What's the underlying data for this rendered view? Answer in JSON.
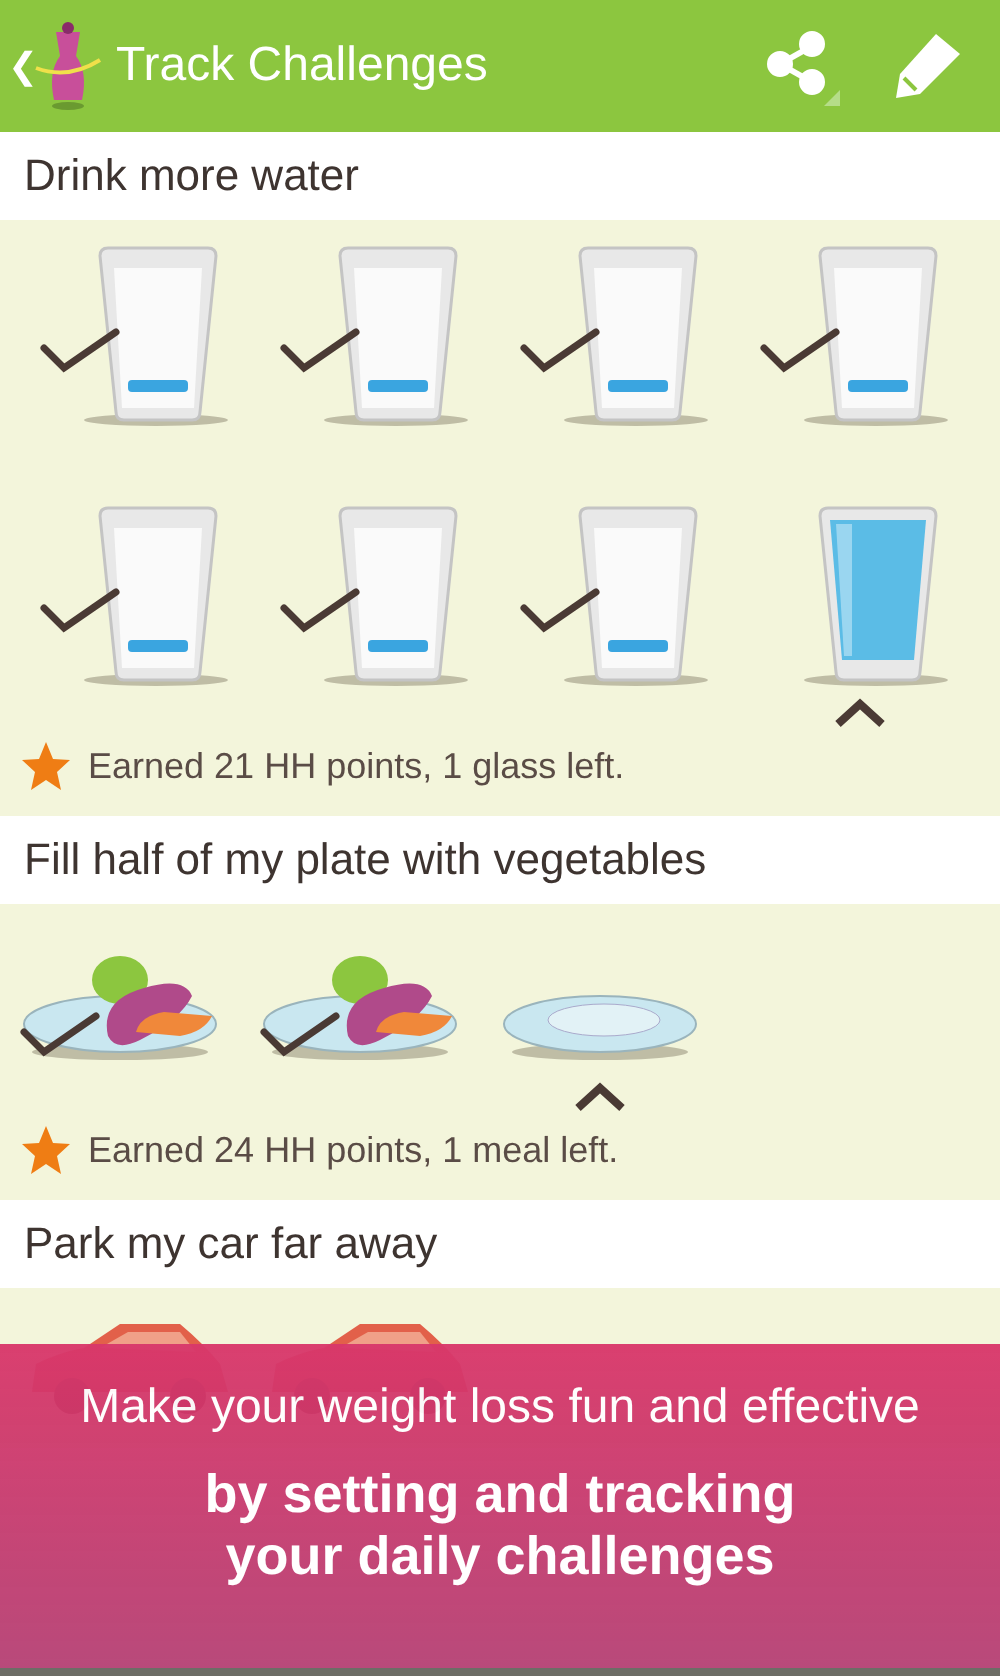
{
  "header": {
    "title": "Track Challenges",
    "back_glyph": "❮"
  },
  "challenges": [
    {
      "title": "Drink more water",
      "status": "Earned 21 HH points, 1 glass left.",
      "items": [
        {
          "kind": "glass",
          "done": true,
          "selected": false
        },
        {
          "kind": "glass",
          "done": true,
          "selected": false
        },
        {
          "kind": "glass",
          "done": true,
          "selected": false
        },
        {
          "kind": "glass",
          "done": true,
          "selected": false
        },
        {
          "kind": "glass",
          "done": true,
          "selected": false
        },
        {
          "kind": "glass",
          "done": true,
          "selected": false
        },
        {
          "kind": "glass",
          "done": true,
          "selected": false
        },
        {
          "kind": "glass",
          "done": false,
          "selected": true
        }
      ]
    },
    {
      "title": "Fill half of my plate with vegetables",
      "status": "Earned 24 HH points, 1 meal left.",
      "items": [
        {
          "kind": "plate",
          "done": true,
          "selected": false
        },
        {
          "kind": "plate",
          "done": true,
          "selected": false
        },
        {
          "kind": "plate",
          "done": false,
          "selected": true
        }
      ]
    },
    {
      "title": "Park my car far away",
      "items": [
        {
          "kind": "car"
        },
        {
          "kind": "car"
        }
      ]
    }
  ],
  "banner": {
    "lines": [
      "Make your weight loss fun and effective",
      "by setting and tracking your daily challenges"
    ]
  }
}
